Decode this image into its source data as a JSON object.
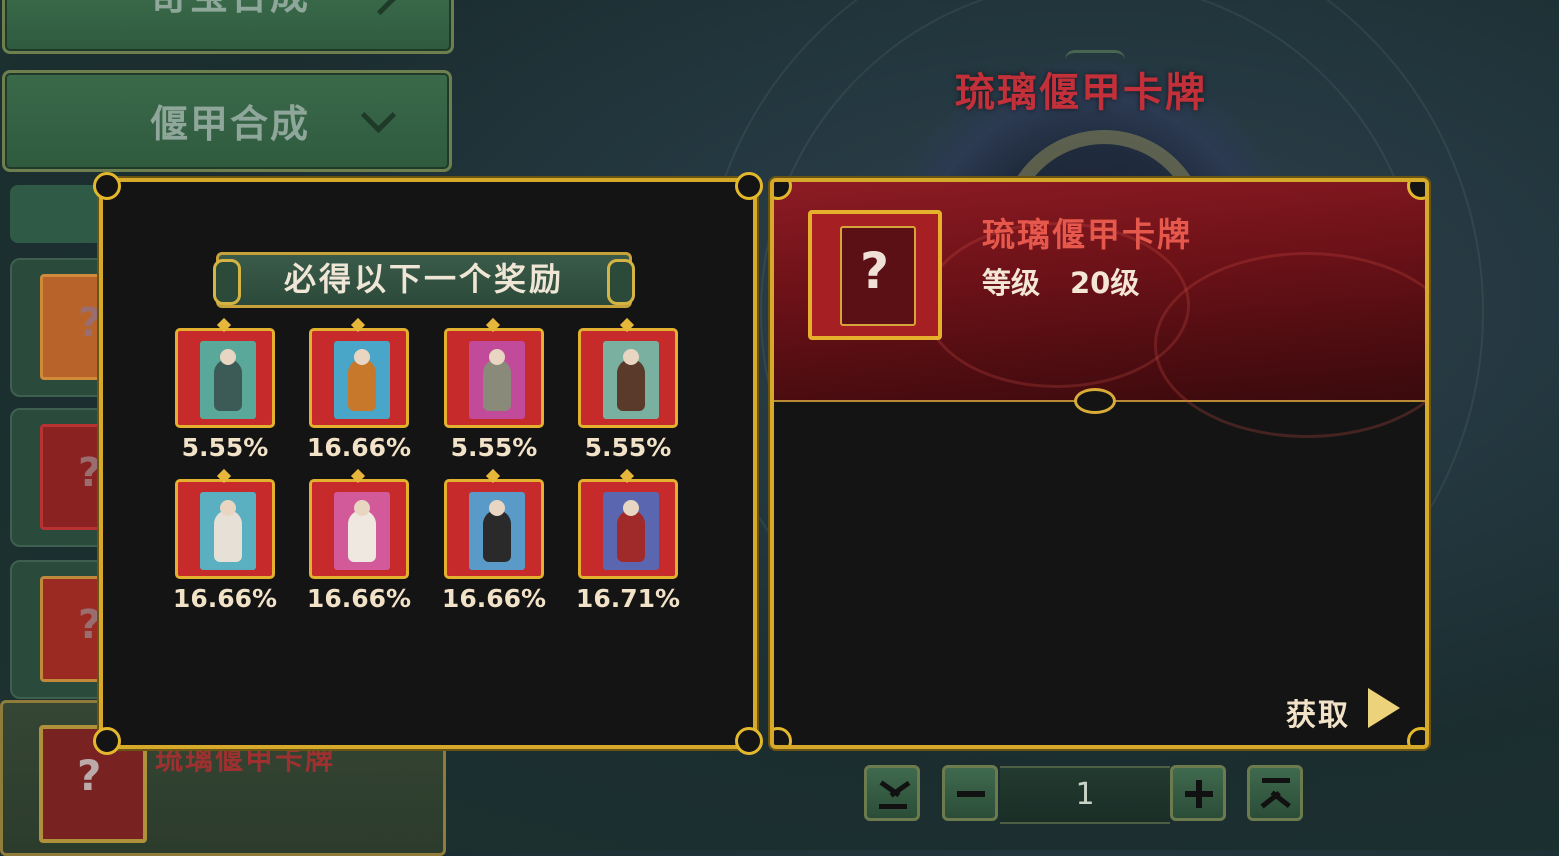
{
  "left_menu": {
    "top_item_label": "奇宝合成",
    "active_item_label": "偃甲合成",
    "bottom_item_name": "琉璃偃甲卡牌"
  },
  "background_title": "琉璃偃甲卡牌",
  "reward_panel": {
    "banner": "必得以下一个奖励",
    "rewards": [
      {
        "chance": "5.55%",
        "icon": "white-beard-elder-portrait"
      },
      {
        "chance": "16.66%",
        "icon": "monkey-king-portrait"
      },
      {
        "chance": "5.55%",
        "icon": "court-official-portrait"
      },
      {
        "chance": "5.55%",
        "icon": "bearded-general-portrait"
      },
      {
        "chance": "16.66%",
        "icon": "white-haired-maiden-portrait"
      },
      {
        "chance": "16.66%",
        "icon": "white-robed-sage-portrait"
      },
      {
        "chance": "16.66%",
        "icon": "golden-haired-warrior-portrait"
      },
      {
        "chance": "16.71%",
        "icon": "elder-lady-portrait"
      }
    ]
  },
  "item_panel": {
    "name": "琉璃偃甲卡牌",
    "level_label": "等级",
    "level_value": "20级",
    "card_symbol": "?",
    "obtain_label": "获取"
  },
  "quantity": {
    "value": "1"
  },
  "colors": {
    "gold": "#d6a92a",
    "red": "#c62a2a",
    "panel": "#141414",
    "green": "#2f5a3e"
  }
}
